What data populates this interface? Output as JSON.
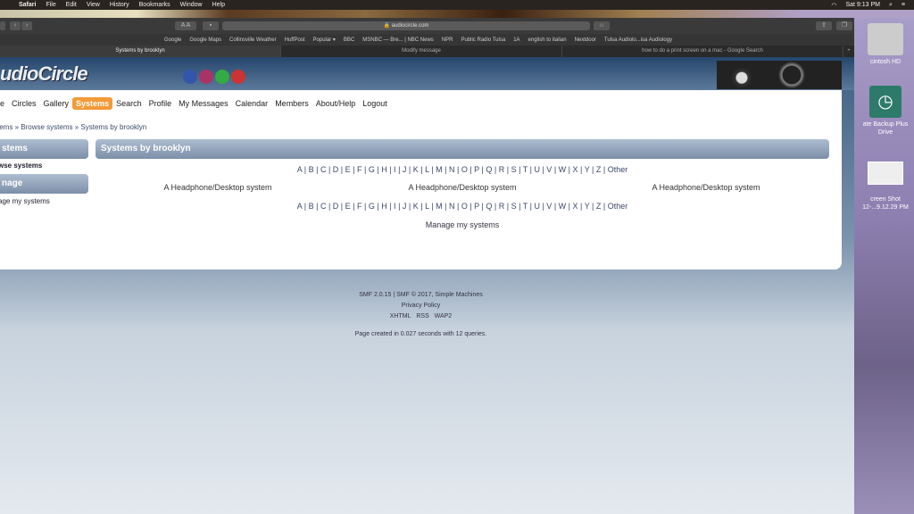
{
  "menubar": {
    "app": "Safari",
    "items": [
      "File",
      "Edit",
      "View",
      "History",
      "Bookmarks",
      "Window",
      "Help"
    ],
    "clock": "Sat 9:13 PM"
  },
  "desktop": {
    "icons": [
      "cintosh HD",
      "ate Backup Plus Drive",
      "creen Shot 12-...9.12.29 PM"
    ]
  },
  "browser": {
    "url": "audiocircle.com",
    "bookmarks": [
      "Google",
      "Google Maps",
      "Collinsville Weather",
      "HuffPost",
      "Popular ▾",
      "BBC",
      "MSNBC — Bre... | NBC News",
      "NPR",
      "Public Radio Tulsa",
      "1A",
      "english to italian",
      "Nextdoor",
      "Tulsa Audiolo...isa Audiology"
    ],
    "tabs": [
      {
        "label": "Systems by brooklyn",
        "active": true
      },
      {
        "label": "Modify message"
      },
      {
        "label": "how to do a print screen on a mac - Google Search"
      }
    ]
  },
  "site": {
    "logo": "udioCircle",
    "nav": [
      "e",
      "Circles",
      "Gallery",
      "Systems",
      "Search",
      "Profile",
      "My Messages",
      "Calendar",
      "Members",
      "About/Help",
      "Logout"
    ],
    "nav_active": "Systems",
    "breadcrumb": [
      "tems",
      "Browse systems",
      "Systems by brooklyn"
    ],
    "sidebar": {
      "systems_header": "stems",
      "browse": "wse systems",
      "manage_header": "nage",
      "manage_link": "age my systems"
    },
    "main": {
      "title": "Systems by brooklyn",
      "letters": [
        "A",
        "B",
        "C",
        "D",
        "E",
        "F",
        "G",
        "H",
        "I",
        "J",
        "K",
        "L",
        "M",
        "N",
        "O",
        "P",
        "Q",
        "R",
        "S",
        "T",
        "U",
        "V",
        "W",
        "X",
        "Y",
        "Z",
        "Other"
      ],
      "systems": [
        "A Headphone/Desktop system",
        "A Headphone/Desktop system",
        "A Headphone/Desktop system"
      ],
      "manage": "Manage my systems"
    },
    "footer": {
      "line1": "SMF 2.0.15 | SMF © 2017, Simple Machines",
      "privacy": "Privacy Policy",
      "xhtml": "XHTML",
      "rss": "RSS",
      "wap2": "WAP2",
      "created": "Page created in 0.027 seconds with 12 queries."
    }
  },
  "colors": {
    "accent": "#f29a37",
    "header": "#7c8fa8"
  }
}
